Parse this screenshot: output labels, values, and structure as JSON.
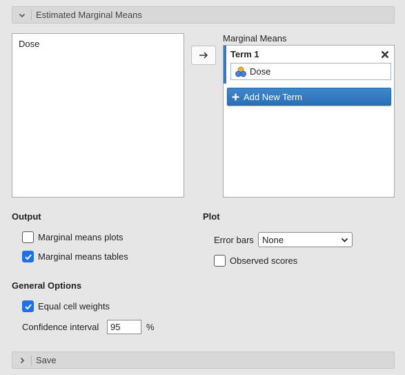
{
  "emm_section": {
    "title": "Estimated Marginal Means",
    "icon": "chevron-down-icon"
  },
  "variables": [
    {
      "label": "Dose"
    }
  ],
  "transfer_button": {
    "icon": "arrow-right-icon"
  },
  "marginal_means": {
    "label": "Marginal Means",
    "terms": [
      {
        "title": "Term 1",
        "items": [
          {
            "label": "Dose",
            "icon": "nominal-variable-icon"
          }
        ]
      }
    ],
    "add_term_label": "Add New Term"
  },
  "output": {
    "heading": "Output",
    "plots": {
      "label": "Marginal means plots",
      "checked": false
    },
    "tables": {
      "label": "Marginal means tables",
      "checked": true
    }
  },
  "plot": {
    "heading": "Plot",
    "error_bars_label": "Error bars",
    "error_bars_value": "None",
    "observed_scores": {
      "label": "Observed scores",
      "checked": false
    }
  },
  "general_options": {
    "heading": "General Options",
    "equal_weights": {
      "label": "Equal cell weights",
      "checked": true
    },
    "ci_label": "Confidence interval",
    "ci_value": "95",
    "ci_unit": "%"
  },
  "save_section": {
    "title": "Save",
    "icon": "chevron-right-icon"
  },
  "colors": {
    "accent": "#1f6fe5",
    "button_blue": "#2a6fb5",
    "term_bar": "#3b78b8"
  }
}
